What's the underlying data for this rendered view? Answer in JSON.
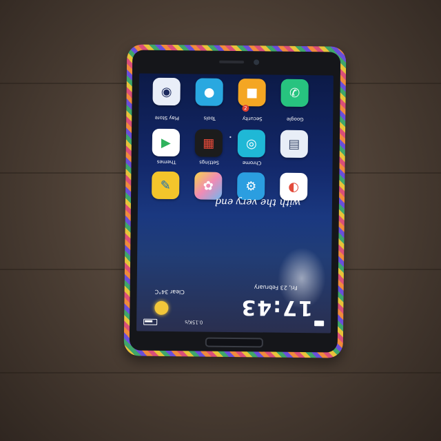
{
  "lockscreen": {
    "time": "17:43",
    "date": "Fri, 23 February",
    "weather": "Clear  34°C",
    "status": "0.15K/s"
  },
  "wallpaper_text": "with the very end",
  "apps": [
    {
      "label": "Tools",
      "icon": "chat-bubble-icon",
      "color": "#29a8e0"
    },
    {
      "label": "Security",
      "icon": "shield-icon",
      "color": "#f4a623"
    },
    {
      "label": "Google",
      "icon": "phone-icon",
      "color": "#27c37f"
    },
    {
      "label": "Play Store",
      "icon": "play-store-icon",
      "color": "#ffffff"
    },
    {
      "label": "Themes",
      "icon": "grid-icon",
      "color": "#1c1c1c"
    },
    {
      "label": "Settings",
      "icon": "camera-icon",
      "color": "#1fb8d6"
    },
    {
      "label": "Chrome",
      "icon": "folder-icon",
      "color": "#e8eef7"
    },
    {
      "label": "",
      "icon": "notes-icon",
      "color": "#f3c52b"
    },
    {
      "label": "",
      "icon": "gallery-icon",
      "color": "#f08bb5"
    },
    {
      "label": "",
      "icon": "gear-icon",
      "color": "#2b9ee0"
    },
    {
      "label": "",
      "icon": "chrome-icon",
      "color": "#ffffff"
    },
    {
      "label": "",
      "icon": "music-icon",
      "color": "#e9eef8"
    }
  ],
  "page_dots": "• • • •"
}
